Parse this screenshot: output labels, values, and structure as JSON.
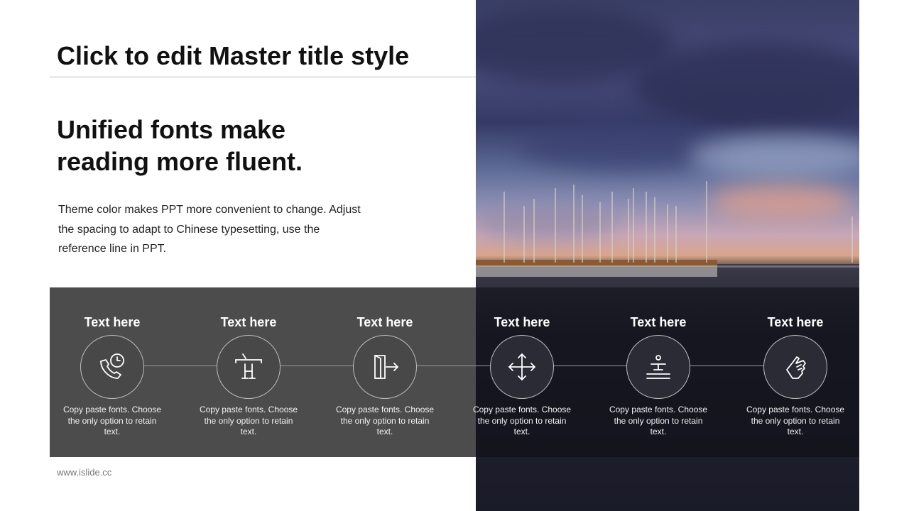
{
  "slide": {
    "title": "Click to edit Master title style",
    "subtitle_line1": "Unified fonts make",
    "subtitle_line2": "reading more fluent.",
    "body": "Theme color makes PPT more convenient to change. Adjust the spacing to adapt to Chinese typesetting, use the reference line in PPT.",
    "footer": "www.islide.cc"
  },
  "steps": [
    {
      "title": "Text here",
      "desc": "Copy paste fonts. Choose the only option to retain text.",
      "icon": "phone-clock-icon"
    },
    {
      "title": "Text here",
      "desc": "Copy paste fonts. Choose the only option to retain text.",
      "icon": "text-cursor-icon"
    },
    {
      "title": "Text here",
      "desc": "Copy paste fonts. Choose the only option to retain text.",
      "icon": "exit-door-icon"
    },
    {
      "title": "Text here",
      "desc": "Copy paste fonts. Choose the only option to retain text.",
      "icon": "move-arrows-icon"
    },
    {
      "title": "Text here",
      "desc": "Copy paste fonts. Choose the only option to retain text.",
      "icon": "podium-icon"
    },
    {
      "title": "Text here",
      "desc": "Copy paste fonts. Choose the only option to retain text.",
      "icon": "hand-pointer-icon"
    }
  ],
  "colors": {
    "band_left": "#484848",
    "band_right": "#0c0c12",
    "title": "#111111"
  }
}
